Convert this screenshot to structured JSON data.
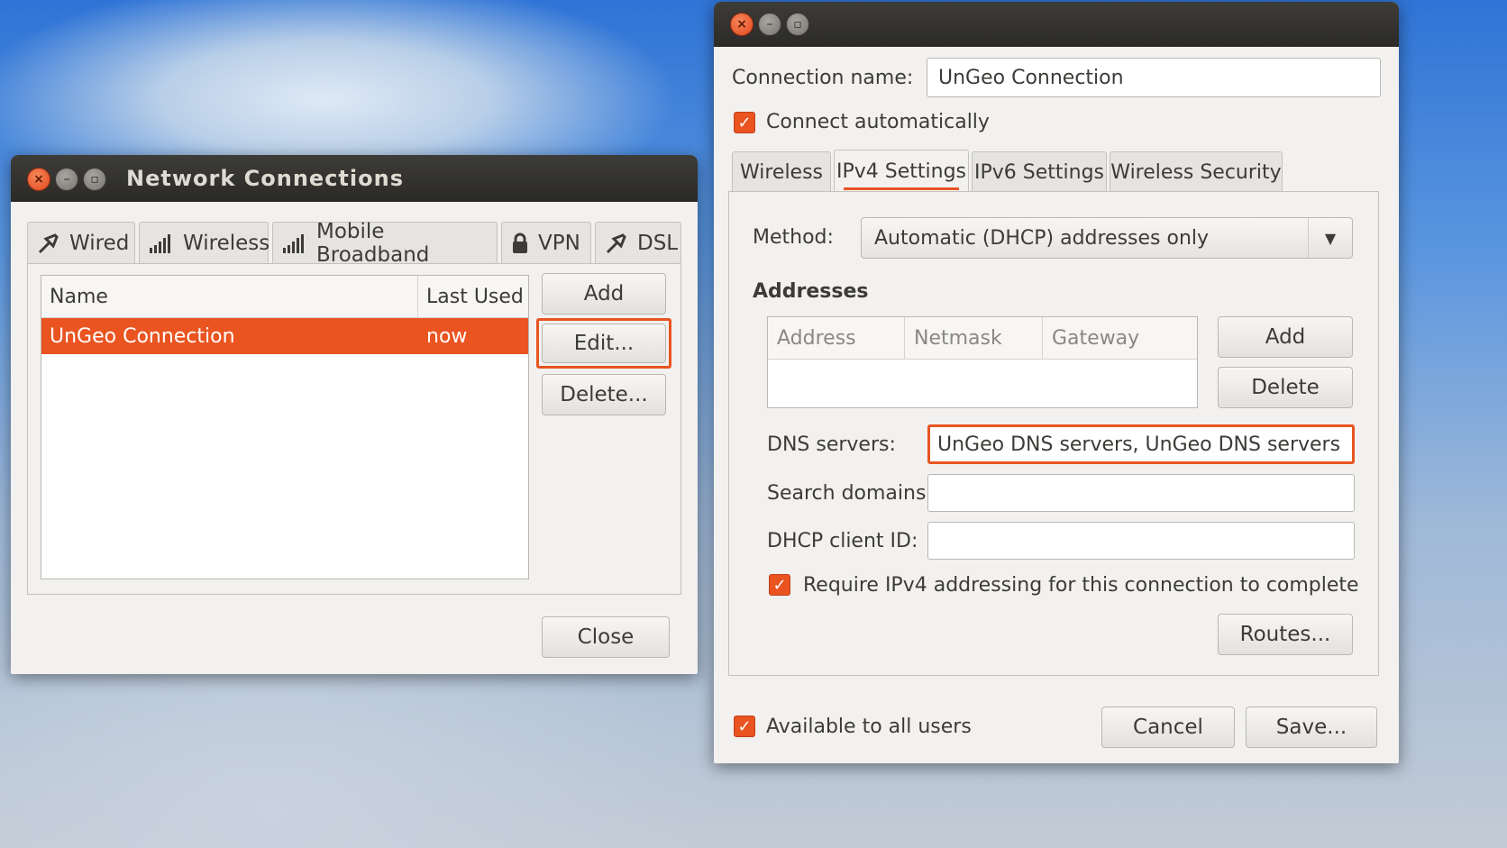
{
  "network_connections": {
    "title": "Network Connections",
    "tabs": [
      {
        "label": "Wired",
        "icon": "plug-icon"
      },
      {
        "label": "Wireless",
        "icon": "signal-icon"
      },
      {
        "label": "Mobile Broadband",
        "icon": "signal-icon"
      },
      {
        "label": "VPN",
        "icon": "lock-icon"
      },
      {
        "label": "DSL",
        "icon": "plug-icon"
      }
    ],
    "columns": {
      "name": "Name",
      "last_used": "Last Used"
    },
    "rows": [
      {
        "name": "UnGeo Connection",
        "last_used": "now",
        "selected": true
      }
    ],
    "buttons": {
      "add": "Add",
      "edit": "Edit...",
      "delete": "Delete...",
      "close": "Close"
    }
  },
  "editor": {
    "connection_name_label": "Connection name:",
    "connection_name_value": "UnGeo Connection",
    "connect_automatically": "Connect automatically",
    "tabs": [
      "Wireless",
      "IPv4 Settings",
      "IPv6 Settings",
      "Wireless Security"
    ],
    "active_tab": "IPv4 Settings",
    "method_label": "Method:",
    "method_value": "Automatic (DHCP) addresses only",
    "addresses_heading": "Addresses",
    "address_columns": {
      "address": "Address",
      "netmask": "Netmask",
      "gateway": "Gateway"
    },
    "address_buttons": {
      "add": "Add",
      "delete": "Delete"
    },
    "dns_label": "DNS servers:",
    "dns_value": "UnGeo DNS servers, UnGeo DNS servers",
    "search_domains_label": "Search domains:",
    "search_domains_value": "",
    "dhcp_client_id_label": "DHCP client ID:",
    "dhcp_client_id_value": "",
    "require_ipv4": "Require IPv4 addressing for this connection to complete",
    "routes_button": "Routes...",
    "available_all_users": "Available to all users",
    "cancel_button": "Cancel",
    "save_button": "Save..."
  },
  "colors": {
    "accent": "#e95420",
    "titlebar": "#2b2a27",
    "window_bg": "#f2f1f0"
  }
}
